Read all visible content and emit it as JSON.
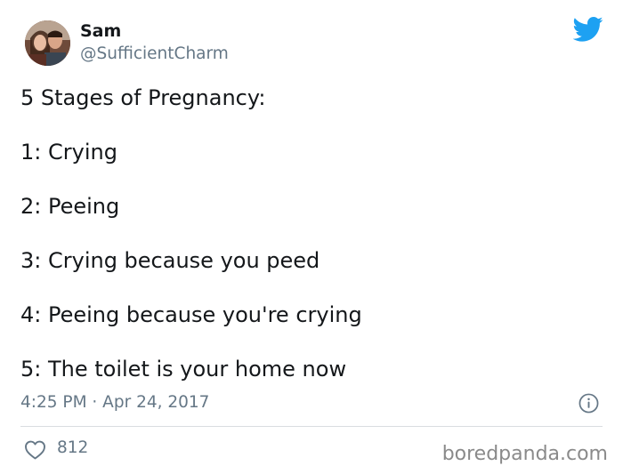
{
  "author": {
    "name": "Sam",
    "handle": "@SufficientCharm"
  },
  "tweet": {
    "lines": [
      "5 Stages of Pregnancy:",
      "1: Crying",
      "2: Peeing",
      "3: Crying because you peed",
      "4: Peeing because you're crying",
      "5: The toilet is your home now"
    ],
    "timestamp": "4:25 PM · Apr 24, 2017",
    "likes": "812"
  },
  "watermark": "boredpanda.com",
  "icons": {
    "brand": "twitter-bird-icon",
    "info": "info-icon",
    "like": "heart-icon"
  },
  "colors": {
    "twitter_blue": "#1da1f2",
    "text": "#14171a",
    "secondary_text": "#657786"
  }
}
